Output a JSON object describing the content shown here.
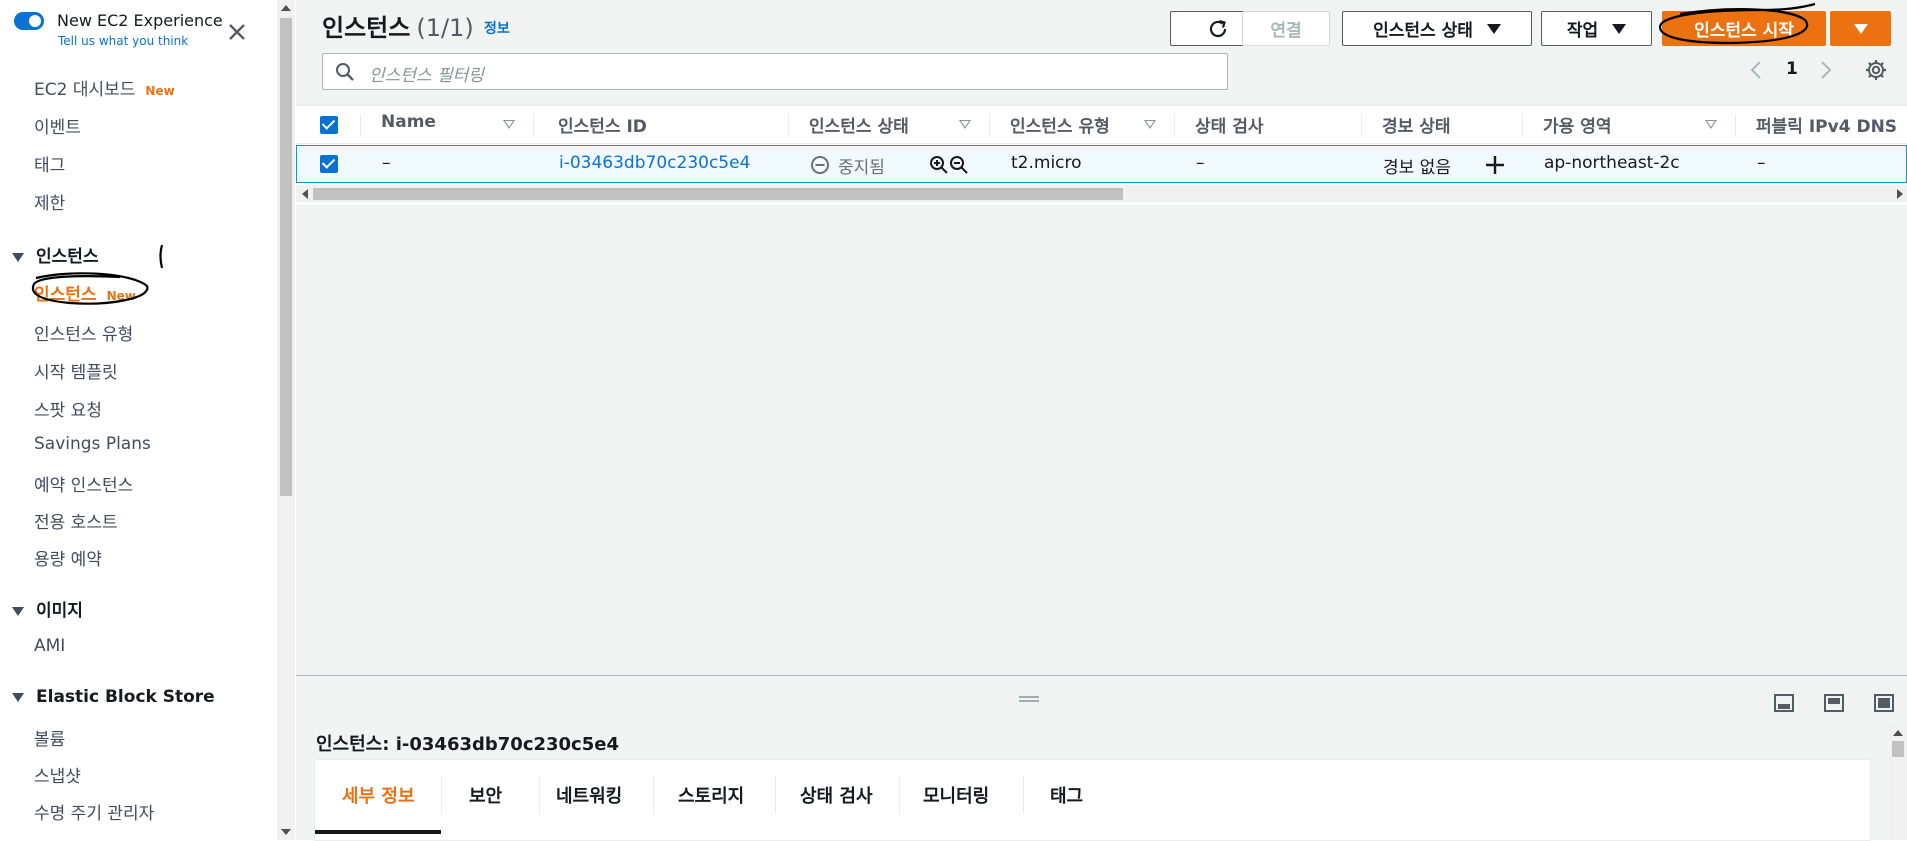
{
  "sidebar": {
    "experience_title": "New EC2 Experience",
    "experience_sub": "Tell us what you think",
    "new_badge": "New",
    "top_items": [
      {
        "label": "EC2 대시보드",
        "new": true
      },
      {
        "label": "이벤트"
      },
      {
        "label": "태그"
      },
      {
        "label": "제한"
      }
    ],
    "sections": [
      {
        "title": "인스턴스",
        "items": [
          "인스턴스",
          "인스턴스 유형",
          "시작 템플릿",
          "스팟 요청",
          "Savings Plans",
          "예약 인스턴스",
          "전용 호스트",
          "용량 예약"
        ]
      },
      {
        "title": "이미지",
        "items": [
          "AMI"
        ]
      },
      {
        "title": "Elastic Block Store",
        "items": [
          "볼륨",
          "스냅샷",
          "수명 주기 관리자"
        ]
      }
    ]
  },
  "header": {
    "title": "인스턴스",
    "count": "(1/1)",
    "info": "정보"
  },
  "toolbar": {
    "connect": "연결",
    "instance_state": "인스턴스 상태",
    "actions": "작업",
    "launch": "인스턴스 시작"
  },
  "search": {
    "placeholder": "인스턴스 필터링"
  },
  "pagination": {
    "page": "1"
  },
  "table": {
    "columns": [
      "Name",
      "인스턴스 ID",
      "인스턴스 상태",
      "인스턴스 유형",
      "상태 검사",
      "경보 상태",
      "가용 영역",
      "퍼블릭 IPv4 DNS"
    ],
    "rows": [
      {
        "name": "–",
        "instance_id": "i-03463db70c230c5e4",
        "state": "중지됨",
        "type": "t2.micro",
        "status_check": "–",
        "alarm": "경보 없음",
        "az": "ap-northeast-2c",
        "dns": "–"
      }
    ]
  },
  "details": {
    "title_prefix": "인스턴스:",
    "title_id": "i-03463db70c230c5e4",
    "tabs": [
      "세부 정보",
      "보안",
      "네트워킹",
      "스토리지",
      "상태 검사",
      "모니터링",
      "태그"
    ]
  },
  "colors": {
    "accent": "#ec7211",
    "link": "#0972d3",
    "annotation_ink": "#000000"
  }
}
